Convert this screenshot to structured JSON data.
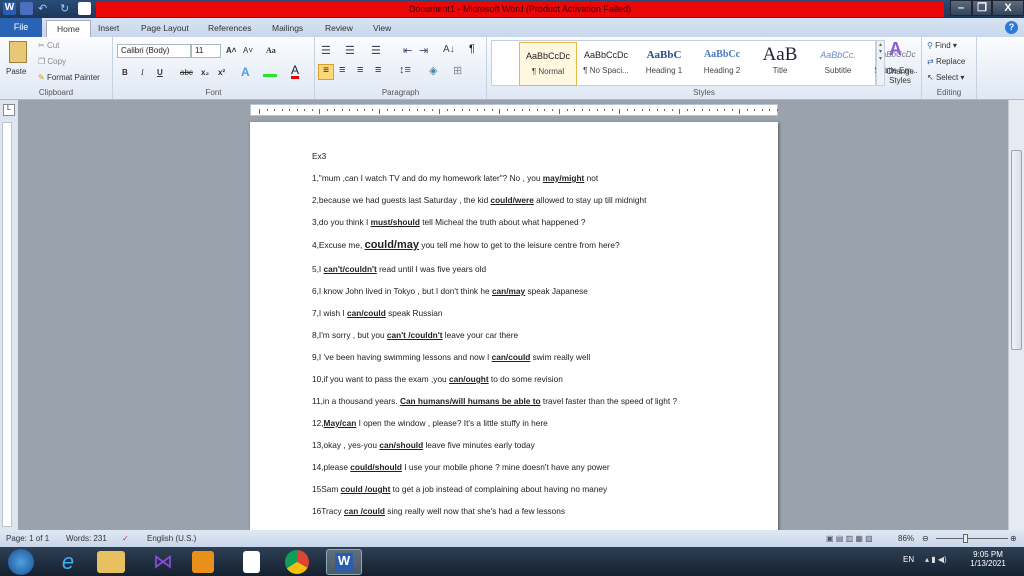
{
  "window": {
    "title": "Document1  -  Microsoft Word (Product Activation Failed)",
    "minimize": "–",
    "restore": "❐",
    "close": "X",
    "help": "?"
  },
  "tabs": [
    "File",
    "Home",
    "Insert",
    "Page Layout",
    "References",
    "Mailings",
    "Review",
    "View"
  ],
  "clipboard": {
    "paste": "Paste",
    "cut": "Cut",
    "copy": "Copy",
    "format_painter": "Format Painter",
    "label": "Clipboard"
  },
  "font": {
    "name": "Calibri (Body)",
    "size": "11",
    "label": "Font",
    "bold": "B",
    "italic": "I",
    "underline": "U",
    "strike": "abc",
    "sub": "x₂",
    "sup": "x²",
    "grow": "A˄",
    "shrink": "A˅",
    "case": "Aa"
  },
  "paragraph": {
    "label": "Paragraph",
    "pilcrow": "¶"
  },
  "styles": {
    "label": "Styles",
    "items": [
      {
        "sample": "AaBbCcDc",
        "name": "¶ Normal"
      },
      {
        "sample": "AaBbCcDc",
        "name": "¶ No Spaci..."
      },
      {
        "sample": "AaBbC",
        "name": "Heading 1"
      },
      {
        "sample": "AaBbCc",
        "name": "Heading 2"
      },
      {
        "sample": "AaB",
        "name": "Title"
      },
      {
        "sample": "AaBbCc.",
        "name": "Subtitle"
      },
      {
        "sample": "AaBbCcDc",
        "name": "Subtle Em..."
      }
    ],
    "change": "Change Styles"
  },
  "editing": {
    "label": "Editing",
    "find": "Find",
    "replace": "Replace",
    "select": "Select"
  },
  "document": {
    "heading": "Ex3",
    "lines": [
      [
        [
          "1,\"mum ,can I watch TV and do my homework later\"? No , you ",
          0
        ],
        [
          "may/might",
          1
        ],
        [
          " not",
          0
        ]
      ],
      [
        [
          "2,because we had guests last Saturday , the kid ",
          0
        ],
        [
          "could/were",
          1
        ],
        [
          " allowed to stay up till midnight",
          0
        ]
      ],
      [
        [
          "3,do you think I ",
          0
        ],
        [
          "must/should",
          1
        ],
        [
          " tell Micheal the truth about what happened ?",
          0
        ]
      ],
      [
        [
          "4,Excuse me, ",
          0
        ],
        [
          "could/may",
          2
        ],
        [
          " you tell me how to get to the leisure centre from here?",
          0
        ]
      ],
      [
        [
          "5,I ",
          0
        ],
        [
          "can't/couldn't",
          1
        ],
        [
          " read until I was five years old",
          0
        ]
      ],
      [
        [
          "6,I know John lived in Tokyo , but I don't think he ",
          0
        ],
        [
          "can/may",
          1
        ],
        [
          " speak Japanese",
          0
        ]
      ],
      [
        [
          "7,I wish I ",
          0
        ],
        [
          "can/could",
          1
        ],
        [
          " speak Russian",
          0
        ]
      ],
      [
        [
          "8,I'm sorry , but you ",
          0
        ],
        [
          "can't /couldn't",
          1
        ],
        [
          " leave your car there",
          0
        ]
      ],
      [
        [
          "9,I 've been having swimming lessons and now I ",
          0
        ],
        [
          "can/could",
          1
        ],
        [
          " swim really well",
          0
        ]
      ],
      [
        [
          "10,if you want to pass the exam ,you ",
          0
        ],
        [
          "can/ought",
          1
        ],
        [
          " to do some revision",
          0
        ]
      ],
      [
        [
          "11,in a thousand years. ",
          0
        ],
        [
          "Can humans/will humans be able to",
          1
        ],
        [
          " travel faster than the speed of light ?",
          0
        ]
      ],
      [
        [
          "12,",
          0
        ],
        [
          "May/can",
          1
        ],
        [
          " I open the window , please? It's a little stuffy in here",
          0
        ]
      ],
      [
        [
          "13,okay , yes-you ",
          0
        ],
        [
          "can/should",
          1
        ],
        [
          " leave five minutes early today",
          0
        ]
      ],
      [
        [
          "14,please ",
          0
        ],
        [
          "could/should",
          1
        ],
        [
          " I use your mobile phone ? mine doesn't have any power",
          0
        ]
      ],
      [
        [
          "15Sam ",
          0
        ],
        [
          "could /ought",
          1
        ],
        [
          " to get a job instead of complaining about having no maney",
          0
        ]
      ],
      [
        [
          "16Tracy ",
          0
        ],
        [
          "can /could",
          1
        ],
        [
          " sing really well now that she's had a few lessons",
          0
        ]
      ]
    ]
  },
  "status": {
    "page": "Page: 1 of 1",
    "words": "Words: 231",
    "language": "English (U.S.)",
    "zoom": "86%"
  },
  "taskbar": {
    "lang": "EN",
    "time": "9:05 PM",
    "date": "1/13/2021"
  }
}
